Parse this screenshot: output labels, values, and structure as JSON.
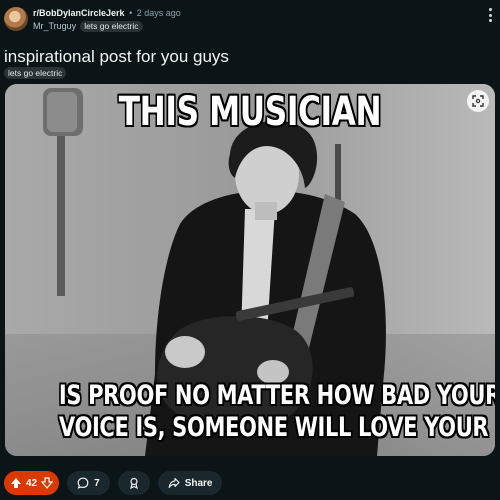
{
  "post": {
    "subreddit": "r/BobDylanCircleJerk",
    "separator": "•",
    "time_ago": "2 days ago",
    "author": "Mr_Truguy",
    "author_flair": "lets go electric",
    "title": "inspirational post for you guys",
    "post_flair": "lets go electric"
  },
  "media": {
    "top_text": "THIS MUSICIAN",
    "bottom_line1": "IS PROOF NO MATTER HOW BAD YOUR",
    "bottom_line2": "VOICE IS, SOMEONE WILL LOVE YOUR MUSIC"
  },
  "actions": {
    "upvotes": "42",
    "comments": "7",
    "share_label": "Share"
  },
  "colors": {
    "background": "#0b1416",
    "upvote_active": "#d93a00",
    "pill": "#1a282d"
  },
  "icons": [
    "overflow-menu-icon",
    "expand-icon",
    "upvote-icon",
    "downvote-icon",
    "comment-icon",
    "award-icon",
    "share-icon"
  ]
}
